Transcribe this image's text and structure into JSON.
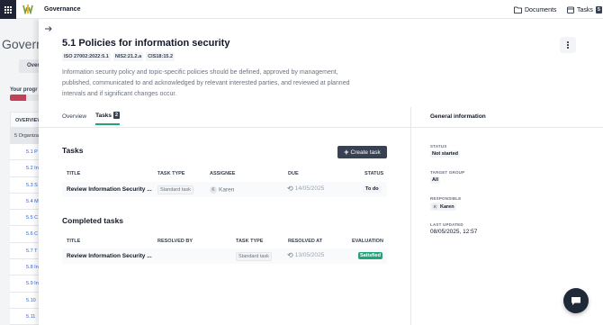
{
  "topbar": {
    "brand": "Governance",
    "documents_label": "Documents",
    "tasks_label": "Tasks",
    "tasks_count": "5"
  },
  "background": {
    "page_title": "Govern",
    "tab_label": "Overv",
    "progress_label": "Your progr",
    "progress_fraction": 0.55,
    "progress_color": "#c24158",
    "table_header": "OVERVIEW",
    "group_row": "5 Organiza",
    "rows": [
      "5.1 P",
      "5.2 In",
      "5.3 S",
      "5.4 M",
      "5.5 C",
      "5.6 C",
      "5.7 T",
      "5.8 In",
      "5.9 In",
      "5.10",
      "5.11"
    ]
  },
  "panel": {
    "title": "5.1 Policies for information security",
    "tags": [
      "ISO 27002:2022:5.1",
      "NIS2:21.2.a",
      "CIS18:15.2"
    ],
    "description": "Information security policy and topic-specific policies should be defined, approved by management, published, communicated to and acknowledged by relevant interested parties, and reviewed at planned intervals and if significant changes occur.",
    "tabs": [
      {
        "label": "Overview"
      },
      {
        "label": "Tasks",
        "count": "2"
      }
    ]
  },
  "tasks": {
    "heading": "Tasks",
    "create_label": "Create task",
    "columns": {
      "title": "TITLE",
      "task_type": "TASK TYPE",
      "assignee": "ASSIGNEE",
      "due": "DUE",
      "status": "STATUS"
    },
    "rows": [
      {
        "title": "Review Information Security ...",
        "task_type": "Standard task",
        "assignee_initial": "K",
        "assignee": "Karen",
        "due": "14/05/2025",
        "status": "To do"
      }
    ]
  },
  "completed": {
    "heading": "Completed tasks",
    "columns": {
      "title": "TITLE",
      "resolved_by": "RESOLVED BY",
      "task_type": "TASK TYPE",
      "resolved_at": "RESOLVED AT",
      "evaluation": "EVALUATION"
    },
    "rows": [
      {
        "title": "Review Information Security ...",
        "resolved_by": "",
        "task_type": "Standard task",
        "resolved_at": "13/05/2025",
        "evaluation": "Satisfied"
      }
    ]
  },
  "general": {
    "heading": "General information",
    "status_label": "STATUS",
    "status_value": "Not started",
    "target_group_label": "TARGET GROUP",
    "target_group_value": "All",
    "responsible_label": "RESPONSIBLE",
    "responsible_initial": "K",
    "responsible_value": "Karen",
    "last_updated_label": "LAST UPDATED",
    "last_updated_value": "08/05/2025, 12:57"
  },
  "colors": {
    "accent": "#22a37a",
    "dark": "#374151",
    "sidebar": "#1e2433"
  },
  "icons": [
    "app-grid-icon",
    "logo-icon",
    "folder-icon",
    "calendar-icon",
    "arrow-right-icon",
    "more-vertical-icon",
    "plus-icon",
    "clock-icon",
    "chat-icon"
  ]
}
